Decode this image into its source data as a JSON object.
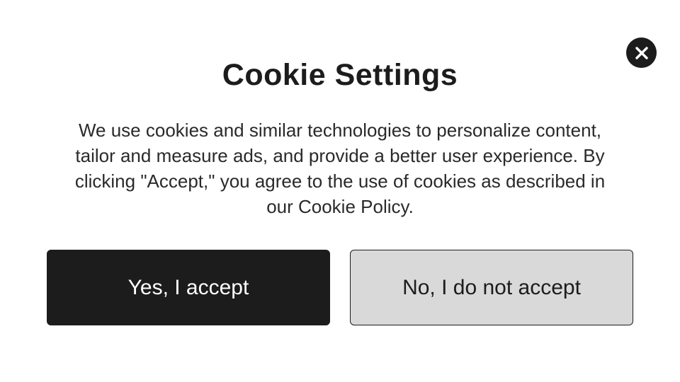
{
  "dialog": {
    "close_icon": "close-icon",
    "title": "Cookie Settings",
    "body": "We use cookies and similar technologies to personalize content, tailor and measure ads, and provide a better user experience. By clicking \"Accept,\" you agree to the use of cookies as described in our Cookie Policy.",
    "accept_label": "Yes, I accept",
    "decline_label": "No, I do not accept"
  },
  "colors": {
    "primary": "#1c1c1c",
    "secondary_bg": "#d9d9d9",
    "background": "#ffffff"
  }
}
